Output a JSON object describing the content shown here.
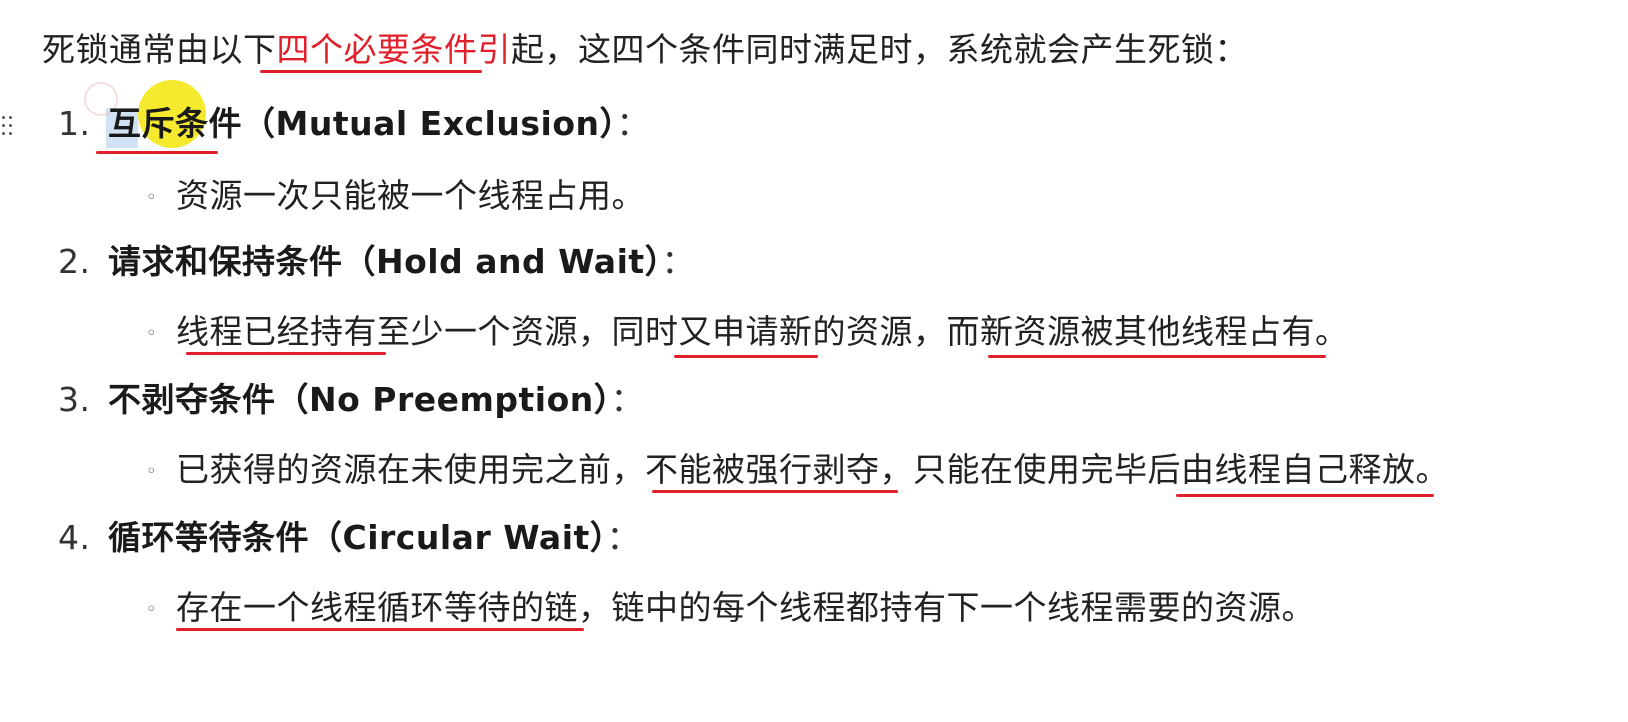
{
  "intro": {
    "before": "死锁通常由以下",
    "highlight": "四个必要条件引",
    "after": "起，这四个条件同时满足时，系统就会产生死锁："
  },
  "conditions": [
    {
      "number": "1.",
      "title": "互斥条件（Mutual Exclusion）",
      "colon": "：",
      "description": [
        "资源一次只能被一个线程占用。"
      ]
    },
    {
      "number": "2.",
      "title": "请求和保持条件（Hold and Wait）",
      "colon": "：",
      "description": [
        "线程已经持有",
        "至少一个资源，同时",
        "又申请新",
        "的资源，而",
        "新资源被其他线程占有",
        "。"
      ]
    },
    {
      "number": "3.",
      "title": "不剥夺条件（No Preemption）",
      "colon": "：",
      "description": [
        "已获得的资源在未使用完之前，",
        "不能被强行剥夺，",
        "只能在使用完毕",
        "后由线程自己释放。"
      ]
    },
    {
      "number": "4.",
      "title": "循环等待条件（Circular Wait）",
      "colon": "：",
      "description": [
        "存在一个线程循环等待的链",
        "，链中的每个线程都持有下一个线程需要的资源。"
      ]
    }
  ],
  "annotation_color": "#e0202a",
  "cursor_highlight_color": "#f5e60a"
}
